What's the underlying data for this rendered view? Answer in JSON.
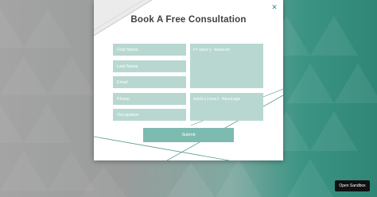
{
  "modal": {
    "title": "Book A Free Consultation",
    "close_icon": "close-icon",
    "fields": {
      "first_name": {
        "placeholder": "First Name",
        "value": ""
      },
      "last_name": {
        "placeholder": "Last Name",
        "value": ""
      },
      "email": {
        "placeholder": "Email",
        "value": ""
      },
      "phone": {
        "placeholder": "Phone",
        "value": ""
      },
      "occupation": {
        "placeholder": "Occupation",
        "value": ""
      },
      "primary_reason": {
        "placeholder": "Primary Reason",
        "value": ""
      },
      "additional_message": {
        "placeholder": "Additional Message",
        "value": ""
      }
    },
    "submit_label": "Submit"
  },
  "sandbox_button_label": "Open Sandbox",
  "colors": {
    "accent": "#3a8c85",
    "field_bg": "#b8d7d1",
    "submit_bg": "#7dbbb0",
    "title": "#3f3f3f"
  }
}
